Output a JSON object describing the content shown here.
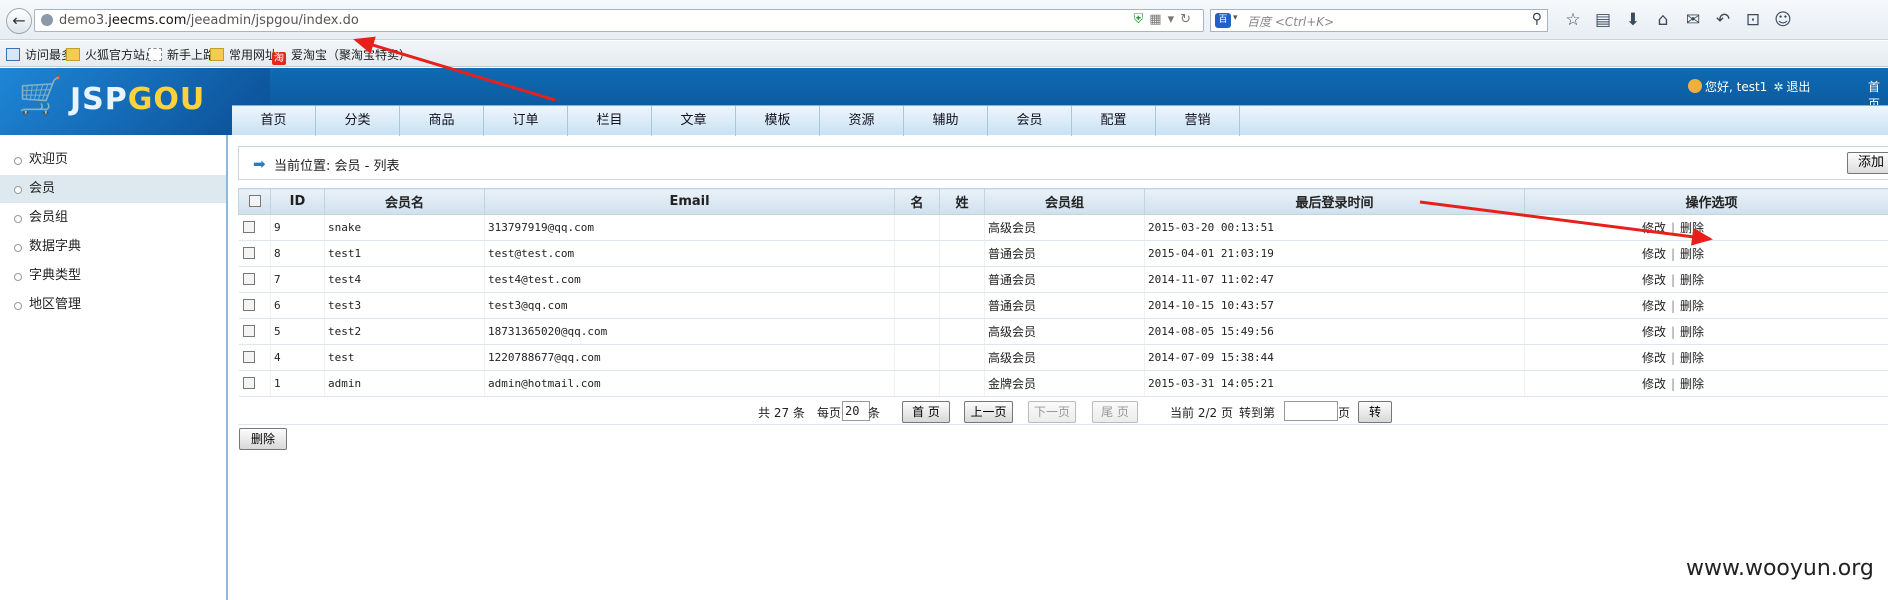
{
  "browser": {
    "url_host_prefix": "demo3.",
    "url_host_main": "jeecms.com",
    "url_path": "/jeeadmin/jspgou/index.do",
    "search_engine_label": "百",
    "search_placeholder": "百度 <Ctrl+K>",
    "toolbar_icons": [
      "star-icon",
      "clipboard-icon",
      "download-icon",
      "home-icon",
      "chat-icon",
      "undo-icon",
      "crop-icon",
      "smiley-icon"
    ],
    "toolbar_glyphs": [
      "☆",
      "▤",
      "⬇",
      "⌂",
      "✉",
      "↶",
      "⊡",
      "☺"
    ]
  },
  "bookmarks": [
    {
      "label": "访问最多",
      "icon": "most-visited-icon"
    },
    {
      "label": "火狐官方站点",
      "icon": "folder-icon"
    },
    {
      "label": "新手上路",
      "icon": "page-icon"
    },
    {
      "label": "常用网址",
      "icon": "folder-icon"
    },
    {
      "label": "爱淘宝（聚淘宝特卖）",
      "icon": "taobao-icon",
      "icon_text": "淘"
    }
  ],
  "header": {
    "logo_part1": "JSP",
    "logo_part2": "GOU",
    "greeting": "您好, test1",
    "logout": "退出",
    "home_cut": "首页"
  },
  "menu": [
    "首页",
    "分类",
    "商品",
    "订单",
    "栏目",
    "文章",
    "模板",
    "资源",
    "辅助",
    "会员",
    "配置",
    "营销"
  ],
  "sidebar": {
    "items": [
      "欢迎页",
      "会员",
      "会员组",
      "数据字典",
      "字典类型",
      "地区管理"
    ],
    "active_index": 1
  },
  "breadcrumb": "当前位置: 会员 - 列表",
  "add_label": "添加",
  "table": {
    "headers": [
      "ID",
      "会员名",
      "Email",
      "名",
      "姓",
      "会员组",
      "最后登录时间",
      "操作选项"
    ],
    "edit_label": "修改",
    "delete_label": "删除",
    "rows": [
      {
        "id": "9",
        "username": "snake",
        "email": "313797919@qq.com",
        "group": "高级会员",
        "last_login": "2015-03-20 00:13:51"
      },
      {
        "id": "8",
        "username": "test1",
        "email": "test@test.com",
        "group": "普通会员",
        "last_login": "2015-04-01 21:03:19"
      },
      {
        "id": "7",
        "username": "test4",
        "email": "test4@test.com",
        "group": "普通会员",
        "last_login": "2014-11-07 11:02:47"
      },
      {
        "id": "6",
        "username": "test3",
        "email": "test3@qq.com",
        "group": "普通会员",
        "last_login": "2014-10-15 10:43:57"
      },
      {
        "id": "5",
        "username": "test2",
        "email": "18731365020@qq.com",
        "group": "高级会员",
        "last_login": "2014-08-05 15:49:56"
      },
      {
        "id": "4",
        "username": "test",
        "email": "1220788677@qq.com",
        "group": "高级会员",
        "last_login": "2014-07-09 15:38:44"
      },
      {
        "id": "1",
        "username": "admin",
        "email": "admin@hotmail.com",
        "group": "金牌会员",
        "last_login": "2015-03-31 14:05:21"
      }
    ]
  },
  "pager": {
    "total_text": "共 27 条",
    "per_page_label": "每页",
    "per_page_value": "20",
    "per_page_unit": "条",
    "first": "首 页",
    "prev": "上一页",
    "next": "下一页",
    "last": "尾 页",
    "current": "当前 2/2 页",
    "goto_label": "转到第",
    "goto_unit": "页",
    "go": "转"
  },
  "delete_button": "删除",
  "watermark": "www.wooyun.org",
  "colors": {
    "header_blue": "#0f6bb3",
    "annotation_red": "#e8201c",
    "sidebar_active": "#dde9ef"
  }
}
